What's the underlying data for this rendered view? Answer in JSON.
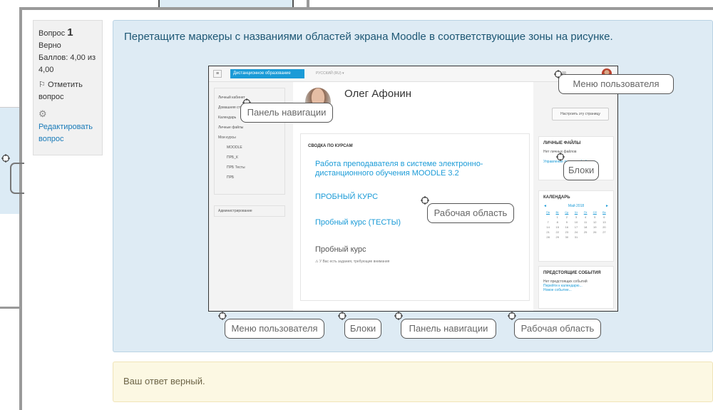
{
  "question_info": {
    "number_prefix": "Вопрос",
    "number": "1",
    "status": "Верно",
    "grade": "Баллов: 4,00 из 4,00",
    "flag_label": "Отметить вопрос",
    "edit_label": "Редактировать вопрос"
  },
  "question": {
    "text": "Перетащите маркеры с названиями областей экрана Moodle в соответствующие зоны на рисунке."
  },
  "screenshot": {
    "brand": "Дистанционное образование",
    "language": "РУССКИЙ (RU) ▾",
    "user_name": "Олег Афонин",
    "customize_button": "Настроить эту страницу",
    "nav_items": [
      "Личный кабинет",
      "Домашняя страница",
      "Календарь",
      "Личные файлы",
      "Мои курсы"
    ],
    "nav_courses": [
      "MOODLE",
      "ПРБ_К",
      "ПРБ Тесты",
      "ПРБ"
    ],
    "admin_item": "Администрирование",
    "course_overview_title": "СВОДКА ПО КУРСАМ",
    "courses": [
      "Работа преподавателя в системе электронно-дистанционного обучения MOODLE 3.2",
      "ПРОБНЫЙ КУРС",
      "Пробный курс (ТЕСТЫ)",
      "Пробный курс"
    ],
    "attention_note": "У Вас есть задания, требующие внимания",
    "files_block_title": "ЛИЧНЫЕ ФАЙЛЫ",
    "files_block_text": "Нет личных файлов",
    "files_block_link": "Управление личными файлами...",
    "calendar_title": "КАЛЕНДАРЬ",
    "calendar_month": "Май 2018",
    "calendar_days": [
      "Пн",
      "Вт",
      "Ср",
      "Чт",
      "Пт",
      "Сб",
      "Вс"
    ],
    "calendar_dates": [
      "",
      "1",
      "2",
      "3",
      "4",
      "5",
      "6",
      "7",
      "8",
      "9",
      "10",
      "11",
      "12",
      "13",
      "14",
      "15",
      "16",
      "17",
      "18",
      "19",
      "20",
      "21",
      "22",
      "23",
      "24",
      "25",
      "26",
      "27",
      "28",
      "29",
      "30",
      "31",
      "",
      "",
      ""
    ],
    "events_title": "ПРЕДСТОЯЩИЕ СОБЫТИЯ",
    "events_text": "Нет предстоящих событий",
    "events_link1": "Перейти к календарю...",
    "events_link2": "Новое событие..."
  },
  "placed_labels": {
    "user_menu": "Меню пользователя",
    "navigation": "Панель навигации",
    "blocks": "Блоки",
    "work_area": "Рабочая область"
  },
  "choices": [
    "Меню пользователя",
    "Блоки",
    "Панель навигации",
    "Рабочая область"
  ],
  "feedback": "Ваш ответ верный."
}
